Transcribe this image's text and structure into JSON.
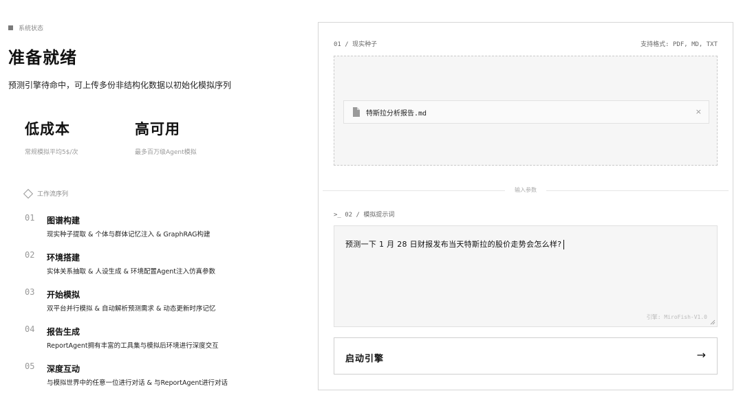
{
  "status": {
    "icon": "square-icon",
    "label": "系统状态"
  },
  "header": {
    "title": "准备就绪",
    "subtitle": "预测引擎待命中，可上传多份非结构化数据以初始化模拟序列"
  },
  "metrics": [
    {
      "value": "低成本",
      "caption": "常规模拟平均5$/次"
    },
    {
      "value": "高可用",
      "caption": "最多百万级Agent模拟"
    }
  ],
  "workflow": {
    "icon": "diamond-icon",
    "heading": "工作流序列",
    "steps": [
      {
        "num": "01",
        "title": "图谱构建",
        "desc": "现实种子提取 & 个体与群体记忆注入 & GraphRAG构建"
      },
      {
        "num": "02",
        "title": "环境搭建",
        "desc": "实体关系抽取 & 人设生成 & 环境配置Agent注入仿真参数"
      },
      {
        "num": "03",
        "title": "开始模拟",
        "desc": "双平台并行模拟 & 自动解析预测需求 & 动态更新时序记忆"
      },
      {
        "num": "04",
        "title": "报告生成",
        "desc": "ReportAgent拥有丰富的工具集与模拟后环境进行深度交互"
      },
      {
        "num": "05",
        "title": "深度互动",
        "desc": "与模拟世界中的任意一位进行对话 & 与ReportAgent进行对话"
      }
    ]
  },
  "panel": {
    "seed_label": "01 / 现实种子",
    "formats": "支持格式: PDF, MD, TXT",
    "file": {
      "icon": "file-icon",
      "name": "特斯拉分析报告.md",
      "close": "×"
    },
    "divider": "输入参数",
    "prompt_label": ">_ 02 / 模拟提示词",
    "prompt_value": "预测一下 1 月 28 日财报发布当天特斯拉的股价走势会怎么样?",
    "engine": "引擎: MiroFish-V1.0",
    "start_label": "启动引擎",
    "start_arrow": "→"
  }
}
